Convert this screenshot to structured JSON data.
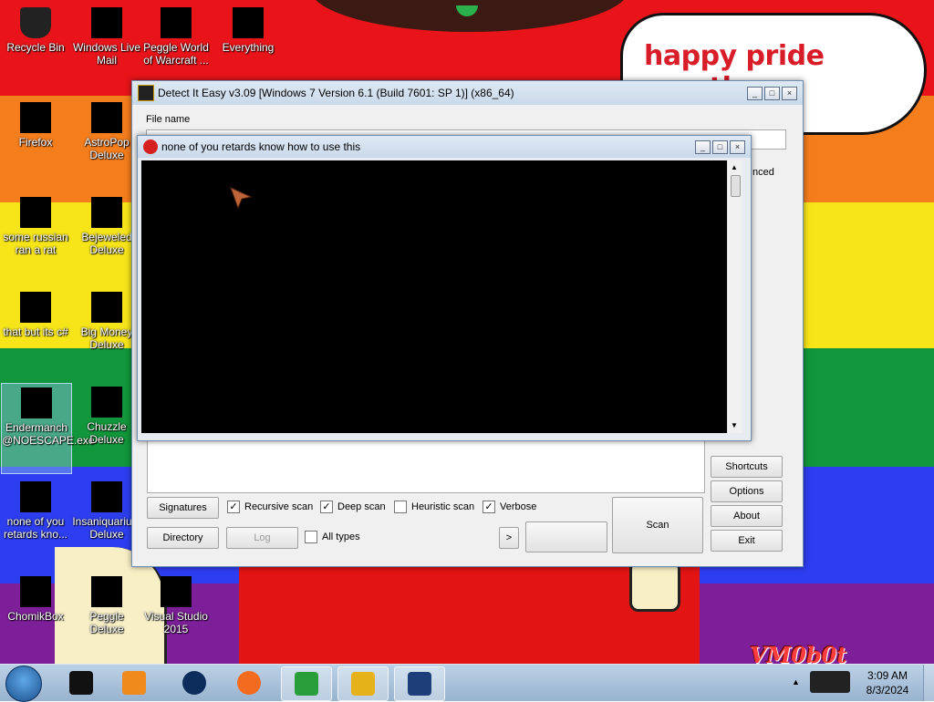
{
  "wallpaper": {
    "bubble_text": "happy pride month",
    "watermark": "VM0b0t",
    "colors": {
      "red": "#e8141a",
      "orange": "#f47d1c",
      "yellow": "#f7e51a",
      "green": "#11963b",
      "blue": "#2d3ef0",
      "purple": "#7c1f98"
    }
  },
  "desktop_icons": [
    {
      "label": "Recycle Bin",
      "icon": "recycle-bin-icon"
    },
    {
      "label": "Windows Live Mail",
      "icon": "mail-icon"
    },
    {
      "label": "Peggle World of Warcraft ...",
      "icon": "peggle-icon"
    },
    {
      "label": "Everything",
      "icon": "search-app-icon"
    },
    {
      "label": "Firefox",
      "icon": "firefox-icon"
    },
    {
      "label": "AstroPop Deluxe",
      "icon": "game-icon"
    },
    {
      "label": "some russian ran a rat",
      "icon": "die-icon"
    },
    {
      "label": "Bejeweled Deluxe",
      "icon": "gem-icon"
    },
    {
      "label": "that but its c#",
      "icon": "windows-icon"
    },
    {
      "label": "Big Money Deluxe",
      "icon": "money-icon"
    },
    {
      "label": "Endermanch @NOESCAPE.exe",
      "icon": "exe-icon"
    },
    {
      "label": "Chuzzle Deluxe",
      "icon": "chuzzle-icon"
    },
    {
      "label": "none of you retards kno...",
      "icon": "app-icon"
    },
    {
      "label": "Insaniquarium Deluxe",
      "icon": "fish-icon"
    },
    {
      "label": "ChomikBox",
      "icon": "box-icon"
    },
    {
      "label": "Peggle Deluxe",
      "icon": "peggle-icon"
    },
    {
      "label": "Visual Studio 2015",
      "icon": "visual-studio-icon"
    }
  ],
  "die_window": {
    "title": "Detect It Easy v3.09 [Windows 7 Version 6.1 (Build 7601: SP 1)] (x86_64)",
    "file_name_label": "File name",
    "advanced_label_partial": "nced",
    "buttons": {
      "signatures": "Signatures",
      "directory": "Directory",
      "log": "Log",
      "scan": "Scan",
      "more": ">",
      "shortcuts": "Shortcuts",
      "options": "Options",
      "about": "About",
      "exit": "Exit"
    },
    "checkboxes": [
      {
        "label": "Recursive scan",
        "checked": true
      },
      {
        "label": "Deep scan",
        "checked": true
      },
      {
        "label": "Heuristic scan",
        "checked": false
      },
      {
        "label": "Verbose",
        "checked": true
      },
      {
        "label": "All types",
        "checked": false
      }
    ]
  },
  "popup_window": {
    "title": "none of you retards know how to use this"
  },
  "taskbar": {
    "time": "3:09 AM",
    "date": "8/3/2024",
    "items": [
      "terminal-icon",
      "media-player-icon",
      "globe-icon",
      "firefox-icon",
      "download-manager-icon",
      "die-icon",
      "window-icon"
    ]
  }
}
